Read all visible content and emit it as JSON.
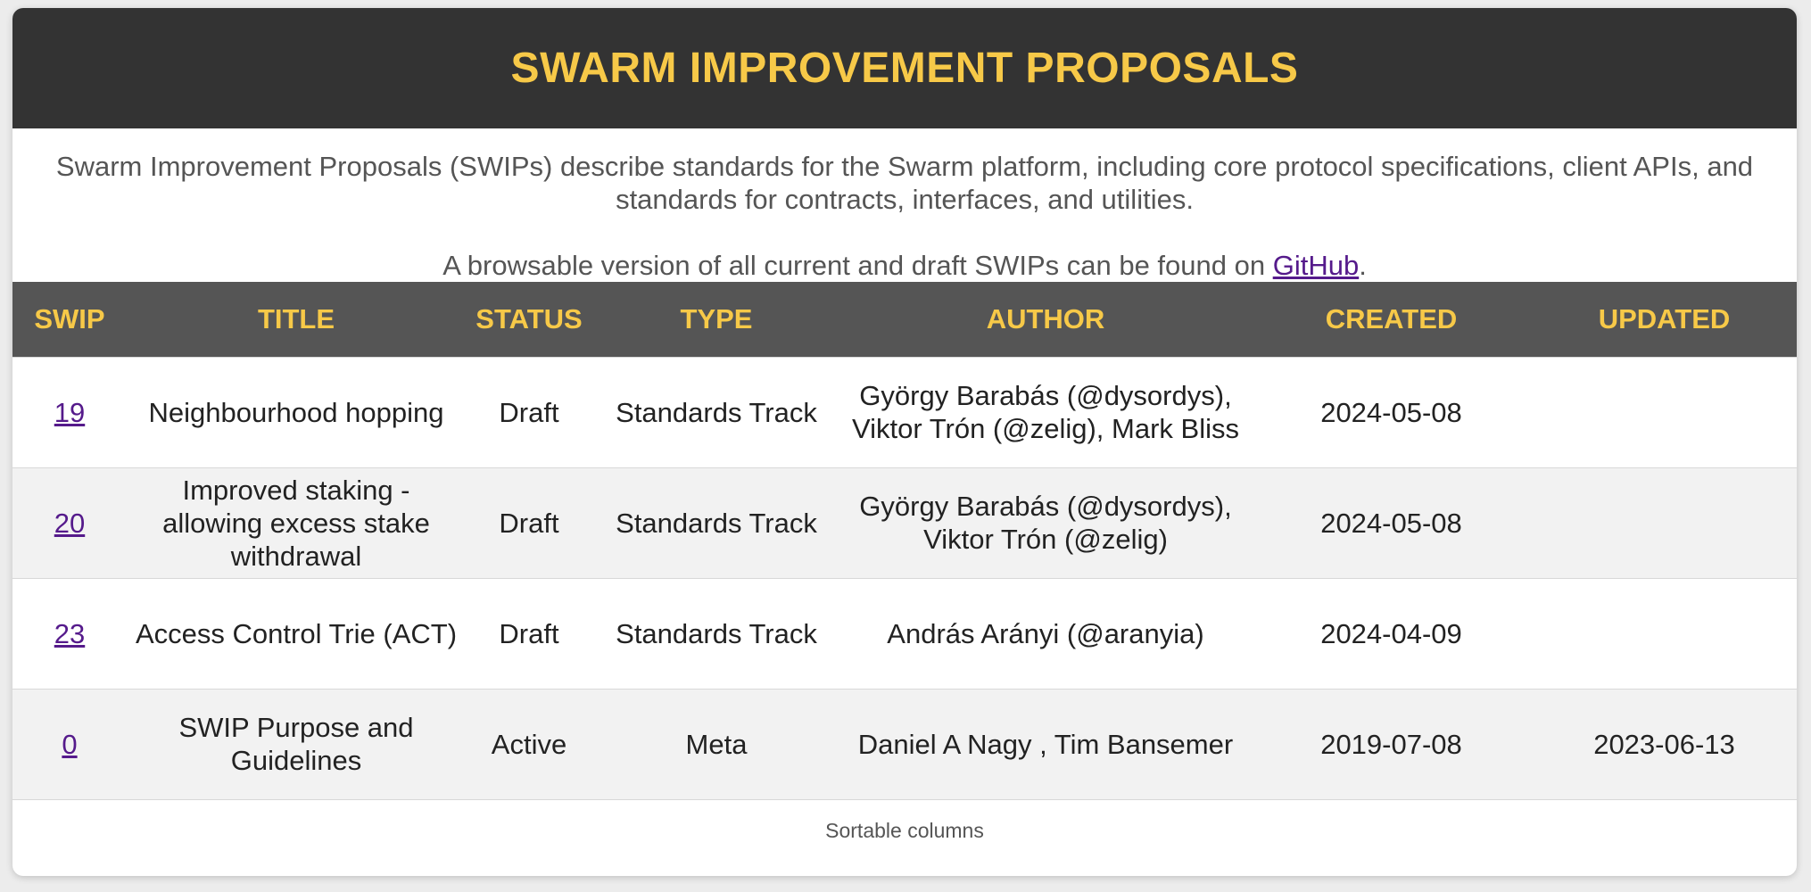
{
  "page": {
    "title": "SWARM IMPROVEMENT PROPOSALS",
    "intro_text": "Swarm Improvement Proposals (SWIPs) describe standards for the Swarm platform, including core protocol specifications, client APIs, and standards for contracts, interfaces, and utilities.",
    "browse_prefix": "A browsable version of all current and draft SWIPs can be found on ",
    "browse_link": "GitHub",
    "browse_suffix": "."
  },
  "colors": {
    "header_bg": "#333333",
    "accent": "#f7c948",
    "table_header_bg": "#555555",
    "link": "#551a8b"
  },
  "table": {
    "columns": [
      "SWIP",
      "TITLE",
      "STATUS",
      "TYPE",
      "AUTHOR",
      "CREATED",
      "UPDATED"
    ],
    "rows": [
      {
        "swip": "19",
        "title": "Neighbourhood hopping",
        "status": "Draft",
        "type": "Standards Track",
        "author": "György Barabás (@dysordys), Viktor Trón (@zelig), Mark Bliss",
        "created": "2024-05-08",
        "updated": ""
      },
      {
        "swip": "20",
        "title": "Improved staking - allowing excess stake withdrawal",
        "status": "Draft",
        "type": "Standards Track",
        "author": "György Barabás (@dysordys), Viktor Trón (@zelig)",
        "created": "2024-05-08",
        "updated": ""
      },
      {
        "swip": "23",
        "title": "Access Control Trie (ACT)",
        "status": "Draft",
        "type": "Standards Track",
        "author": "András Arányi (@aranyia)",
        "created": "2024-04-09",
        "updated": ""
      },
      {
        "swip": "0",
        "title": "SWIP Purpose and Guidelines",
        "status": "Active",
        "type": "Meta",
        "author": "Daniel A Nagy , Tim Bansemer",
        "created": "2019-07-08",
        "updated": "2023-06-13"
      }
    ],
    "footer": "Sortable columns"
  }
}
